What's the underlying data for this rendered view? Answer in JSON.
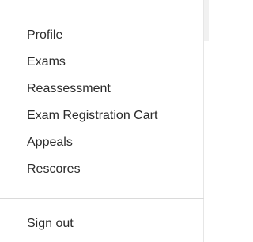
{
  "menu": {
    "items": [
      {
        "label": "Profile"
      },
      {
        "label": "Exams"
      },
      {
        "label": "Reassessment"
      },
      {
        "label": "Exam Registration Cart"
      },
      {
        "label": "Appeals"
      },
      {
        "label": "Rescores"
      }
    ],
    "sign_out_label": "Sign out"
  },
  "colors": {
    "text": "#2b2b2b",
    "divider": "#dadada",
    "background": "#ffffff"
  }
}
